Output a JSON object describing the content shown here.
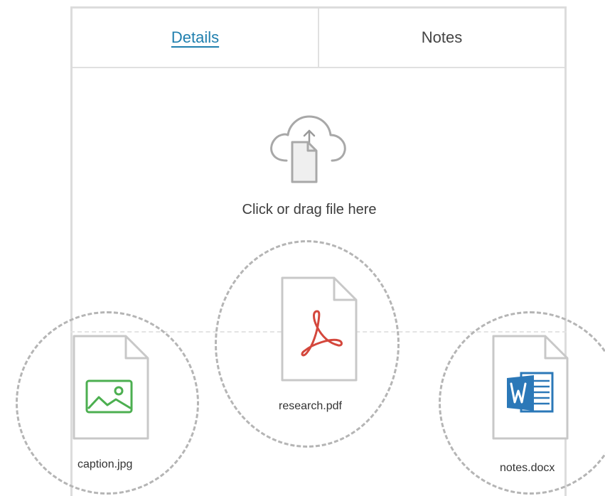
{
  "tabs": [
    {
      "label": "Details",
      "active": true
    },
    {
      "label": "Notes",
      "active": false
    }
  ],
  "upload": {
    "prompt": "Click or drag file here",
    "icon": "cloud-upload-icon"
  },
  "files": [
    {
      "name": "caption.jpg",
      "icon": "image-file-icon",
      "accent": "#4caf50"
    },
    {
      "name": "research.pdf",
      "icon": "pdf-file-icon",
      "accent": "#d4473c"
    },
    {
      "name": "notes.docx",
      "icon": "word-file-icon",
      "accent": "#2b78b8"
    }
  ],
  "colors": {
    "active_tab": "#1f7fae",
    "border": "#dcdcdc",
    "dash": "#b5b5b5"
  }
}
